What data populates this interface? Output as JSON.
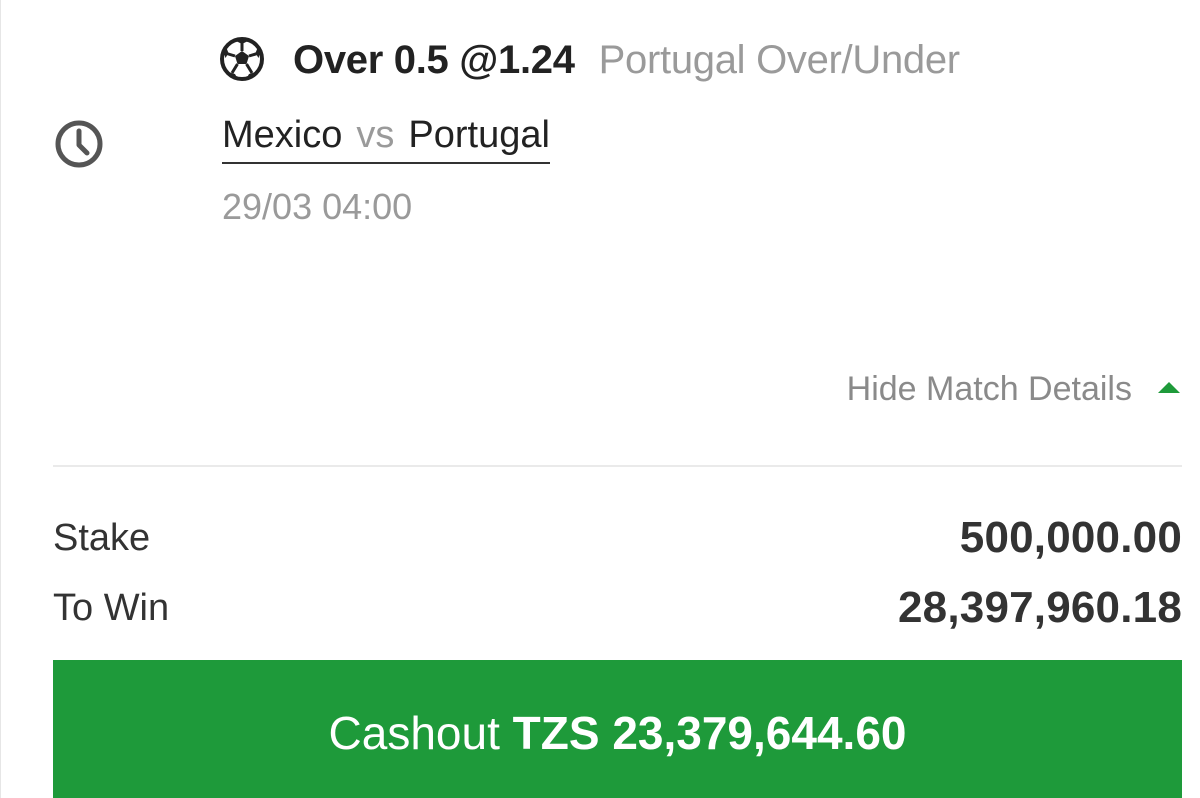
{
  "selection": {
    "sport_icon": "soccer-ball-icon",
    "title": "Over 0.5 @1.24",
    "market": "Portugal Over/Under"
  },
  "match": {
    "status_icon": "clock-icon",
    "home": "Mexico",
    "vs": "vs",
    "away": "Portugal",
    "kickoff": "29/03 04:00"
  },
  "details_toggle": {
    "label": "Hide Match Details",
    "icon": "caret-up-icon"
  },
  "summary": {
    "stake_label": "Stake",
    "stake_value": "500,000.00",
    "to_win_label": "To Win",
    "to_win_value": "28,397,960.18"
  },
  "cashout": {
    "label": "Cashout",
    "currency": "TZS",
    "amount": "23,379,644.60"
  },
  "colors": {
    "accent": "#1e9a3a",
    "muted_text": "#9a9a9a",
    "primary_text": "#222222"
  }
}
